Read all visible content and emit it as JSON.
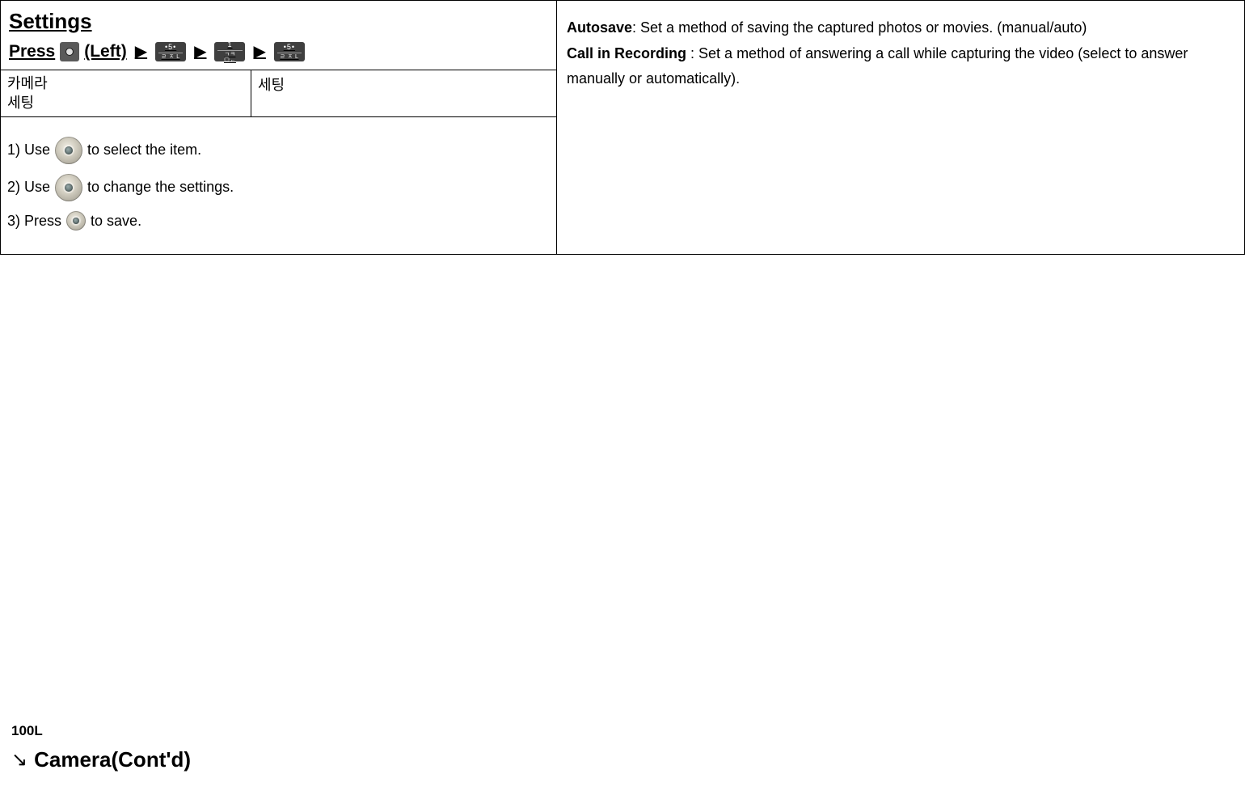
{
  "settings": {
    "title": "Settings",
    "press_prefix": "Press",
    "press_suffix": "(Left)",
    "keys": [
      "5",
      "1",
      "5"
    ],
    "subtable": {
      "col1_line1": "카메라",
      "col1_line2": "세팅",
      "col2": "세팅"
    },
    "steps": [
      {
        "prefix": "1) Use",
        "icon": "nav-wheel",
        "suffix": " to select the item."
      },
      {
        "prefix": "2) Use",
        "icon": "nav-wheel",
        "suffix": " to change the settings."
      },
      {
        "prefix": "3) Press",
        "icon": "nav-center",
        "suffix": "to save."
      }
    ]
  },
  "right": {
    "autosave_label": "Autosave",
    "autosave_text": ": Set a method of saving the captured photos or movies. (manual/auto)",
    "callrec_label": "Call in Recording",
    "callrec_text": " : Set a method of answering a call while capturing the video (select to answer manually or automatically)."
  },
  "footer": {
    "page": "100L",
    "continued": "Camera(Cont'd)"
  }
}
